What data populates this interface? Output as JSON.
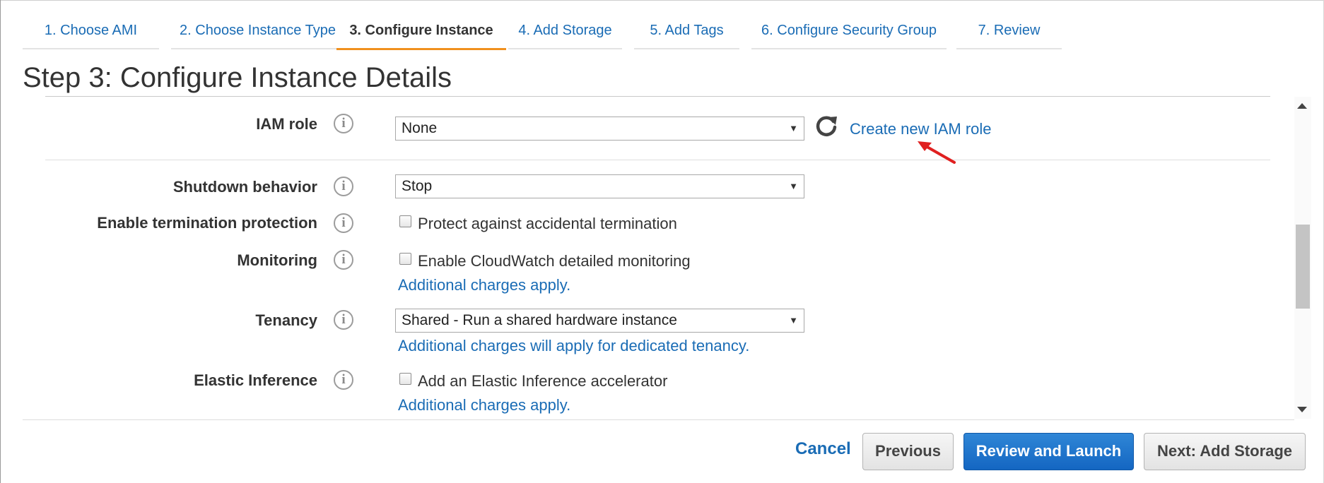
{
  "tabs": [
    {
      "label": "1. Choose AMI"
    },
    {
      "label": "2. Choose Instance Type"
    },
    {
      "label": "3. Configure Instance"
    },
    {
      "label": "4. Add Storage"
    },
    {
      "label": "5. Add Tags"
    },
    {
      "label": "6. Configure Security Group"
    },
    {
      "label": "7. Review"
    }
  ],
  "active_tab": 2,
  "page_title": "Step 3: Configure Instance Details",
  "form": {
    "iam_role": {
      "label": "IAM role",
      "value": "None",
      "create_link": "Create new IAM role"
    },
    "shutdown": {
      "label": "Shutdown behavior",
      "value": "Stop"
    },
    "termination": {
      "label": "Enable termination protection",
      "checkbox_label": "Protect against accidental termination",
      "checked": false
    },
    "monitoring": {
      "label": "Monitoring",
      "checkbox_label": "Enable CloudWatch detailed monitoring",
      "checked": false,
      "note": "Additional charges apply."
    },
    "tenancy": {
      "label": "Tenancy",
      "value": "Shared - Run a shared hardware instance",
      "note": "Additional charges will apply for dedicated tenancy."
    },
    "elastic_inference": {
      "label": "Elastic Inference",
      "checkbox_label": "Add an Elastic Inference accelerator",
      "checked": false,
      "note": "Additional charges apply."
    }
  },
  "info_glyph": "i",
  "caret_glyph": "▼",
  "footer": {
    "cancel": "Cancel",
    "previous": "Previous",
    "review_launch": "Review and Launch",
    "next": "Next: Add Storage"
  },
  "colors": {
    "link": "#1a6cb5",
    "active_tab_underline": "#f0901e",
    "primary_button": "#1f77cf",
    "annotation_arrow": "#e02020"
  },
  "icons": {
    "info": "info-icon",
    "refresh": "refresh-icon",
    "dropdown": "caret-down-icon",
    "annotation": "red-arrow-annotation"
  }
}
